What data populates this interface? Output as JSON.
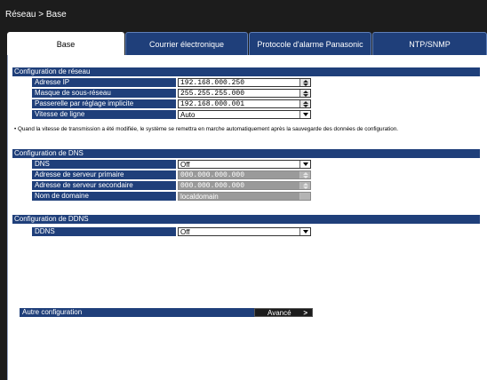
{
  "breadcrumb": "Réseau > Base",
  "tabs": [
    {
      "label": "Base"
    },
    {
      "label": "Courrier électronique"
    },
    {
      "label": "Protocole d'alarme Panasonic"
    },
    {
      "label": "NTP/SNMP"
    }
  ],
  "network": {
    "header": "Configuration de réseau",
    "ip_label": "Adresse IP",
    "ip_value": "192.168.000.250",
    "mask_label": "Masque de sous-réseau",
    "mask_value": "255.255.255.000",
    "gateway_label": "Passerelle par réglage implicite",
    "gateway_value": "192.168.000.001",
    "speed_label": "Vitesse de ligne",
    "speed_value": "Auto",
    "note": "• Quand la vitesse de transmission a été modifiée, le système se remettra en marche automatiquement après la sauvegarde des données de configuration."
  },
  "dns": {
    "header": "Configuration de DNS",
    "dns_label": "DNS",
    "dns_value": "Off",
    "primary_label": "Adresse de serveur primaire",
    "primary_value": "000.000.000.000",
    "secondary_label": "Adresse de serveur secondaire",
    "secondary_value": "000.000.000.000",
    "domain_label": "Nom de domaine",
    "domain_value": "localdomain"
  },
  "ddns": {
    "header": "Configuration de DDNS",
    "ddns_label": "DDNS",
    "ddns_value": "Off"
  },
  "other": {
    "label": "Autre configuration",
    "button_label": "Avancé",
    "button_chevron": ">"
  }
}
